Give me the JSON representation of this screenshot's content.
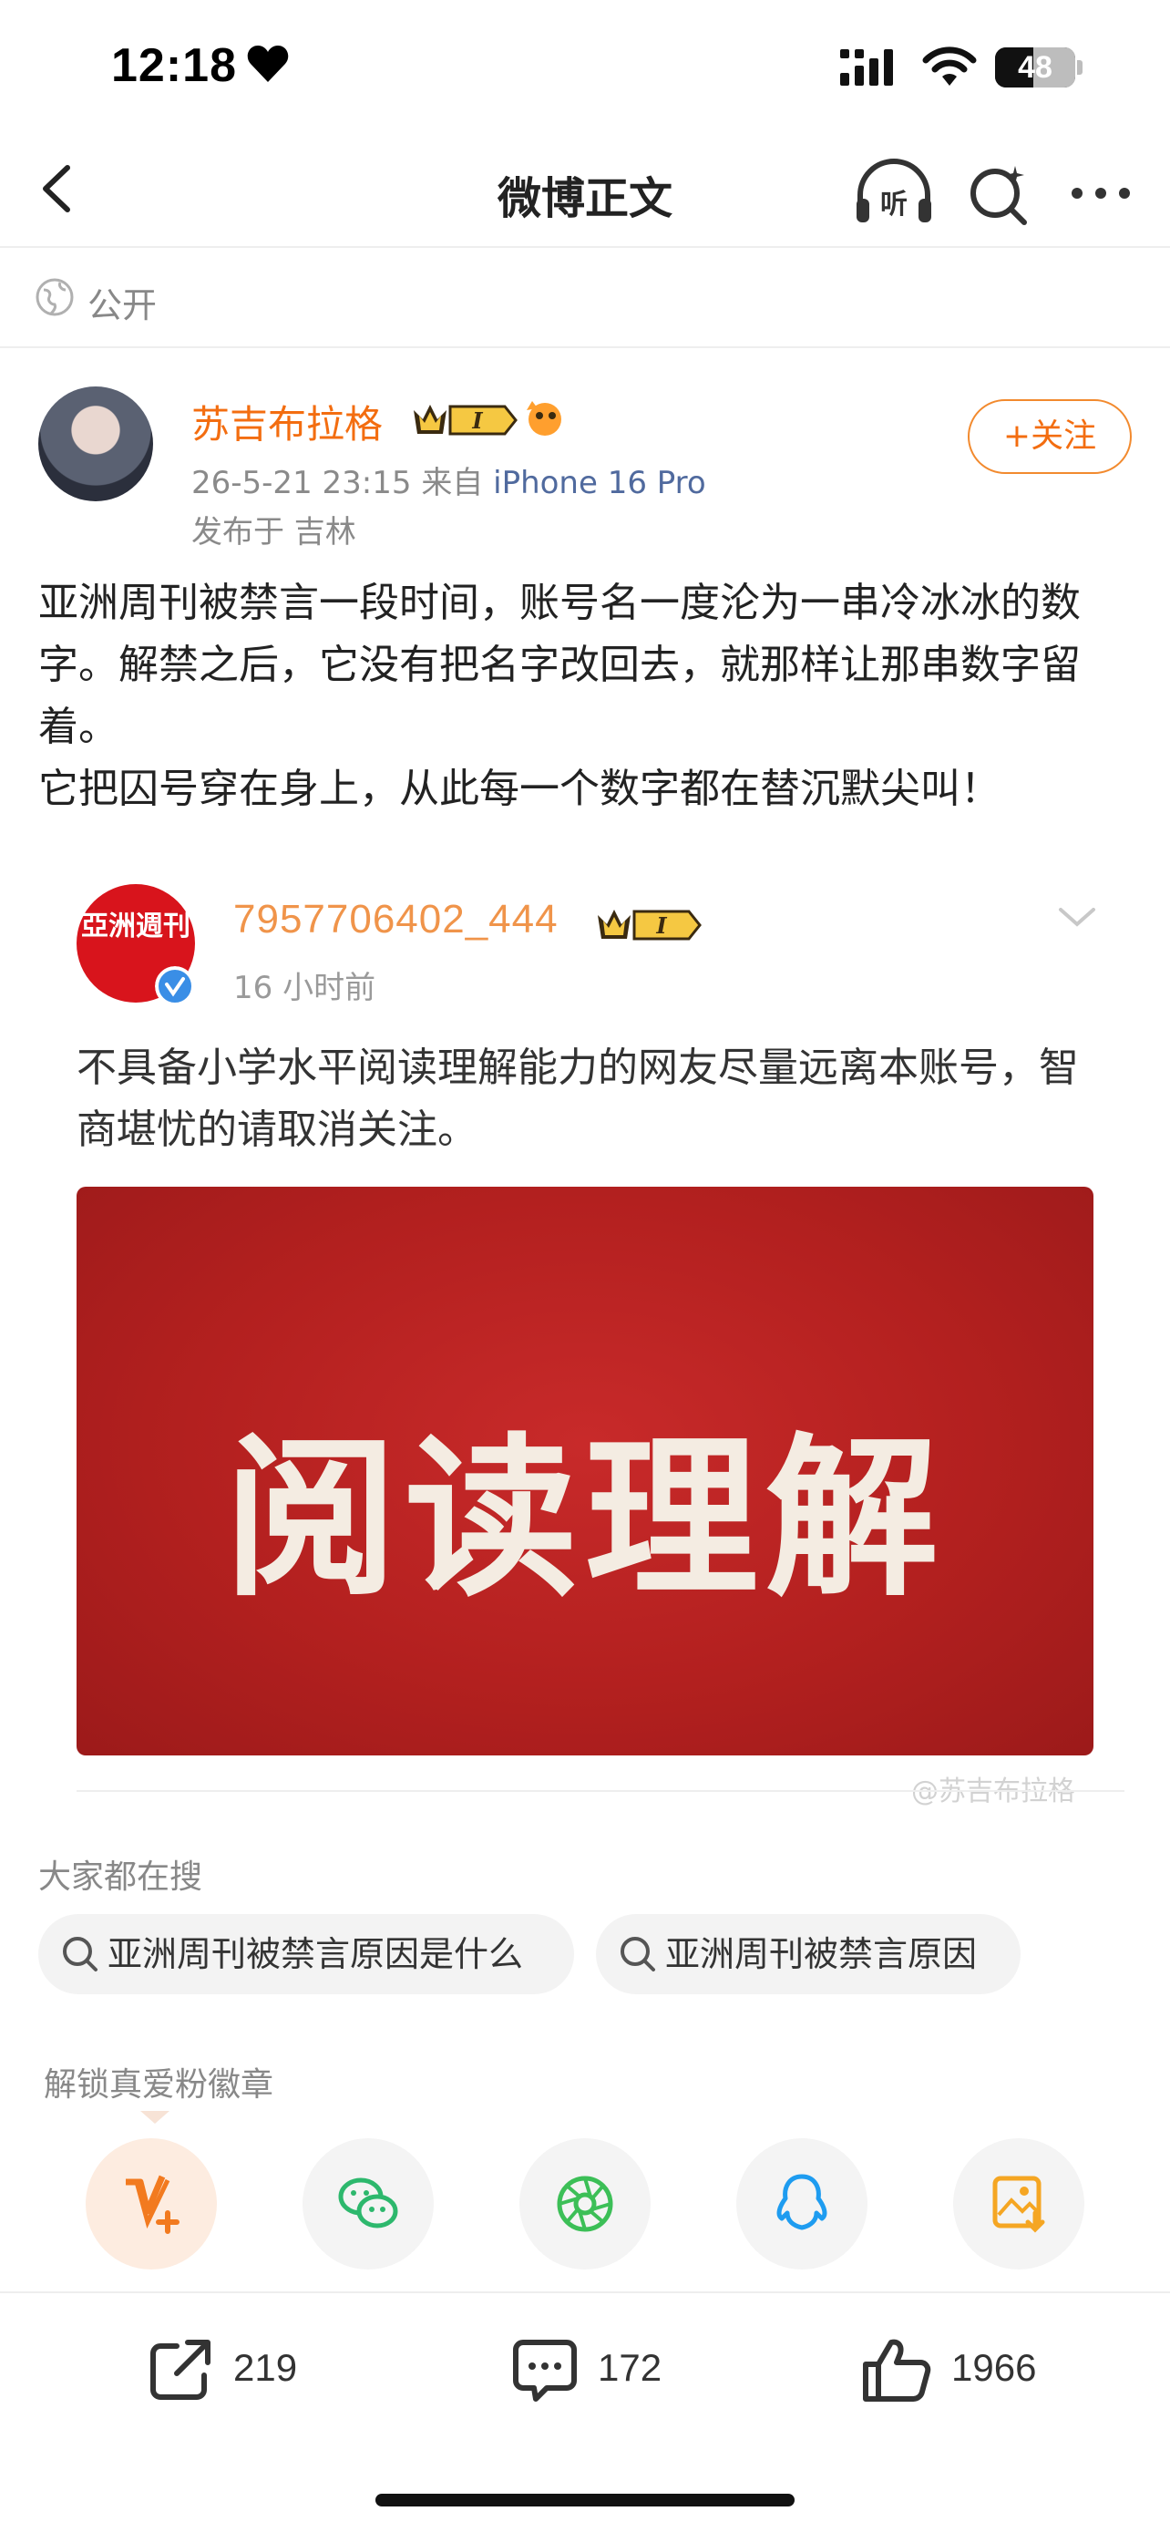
{
  "status_bar": {
    "time": "12:18",
    "battery": "48",
    "battery_level": 0.48
  },
  "nav": {
    "title": "微博正文",
    "listen_label": "听"
  },
  "visibility": {
    "label": "公开"
  },
  "author": {
    "name": "苏吉布拉格",
    "level_badge": "I",
    "timestamp": "26-5-21 23:15",
    "via": "来自",
    "device": "iPhone 16 Pro",
    "location": "发布于 吉林",
    "follow_label": "+关注"
  },
  "post": {
    "text": "亚洲周刊被禁言一段时间，账号名一度沦为一串冷冰冰的数字。解禁之后，它没有把名字改回去，就那样让那串数字留着。\n它把囚号穿在身上，从此每一个数字都在替沉默尖叫！"
  },
  "repost": {
    "avatar_text": "亞洲週刊",
    "name": "7957706402_444",
    "level_badge": "I",
    "time": "16 小时前",
    "text": "不具备小学水平阅读理解能力的网友尽量远离本账号，智商堪忧的请取消关注。",
    "image_text": "阅读理解",
    "watermark": "@苏吉布拉格"
  },
  "hot_search": {
    "title": "大家都在搜",
    "items": [
      "亚洲周刊被禁言原因是什么",
      "亚洲周刊被禁言原因"
    ]
  },
  "fan_badge": {
    "title": "解锁真爱粉徽章"
  },
  "share_targets": [
    "v-plus-icon",
    "wechat-icon",
    "moments-icon",
    "qq-icon",
    "save-image-icon"
  ],
  "actions": {
    "reposts": "219",
    "comments": "172",
    "likes": "1966"
  },
  "colors": {
    "accent": "#f36d10",
    "repost_name": "#f0944a",
    "device_link": "#506a9e",
    "image_red": "#b3201f"
  }
}
